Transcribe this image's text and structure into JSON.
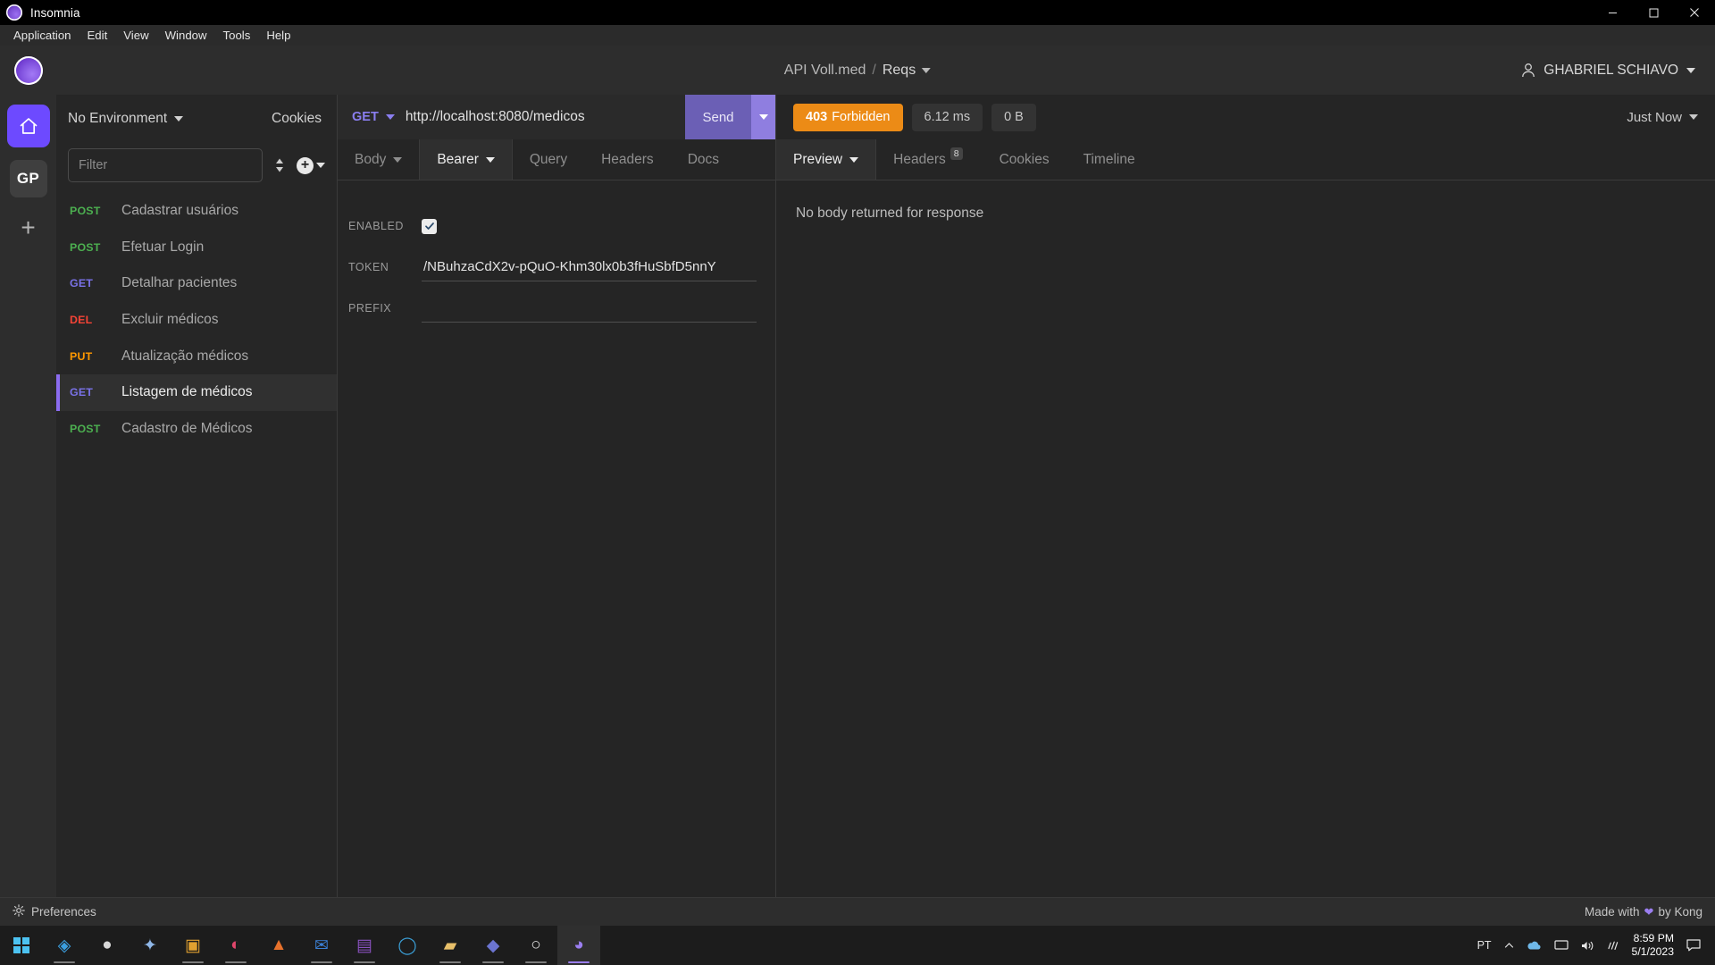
{
  "window": {
    "app_title": "Insomnia",
    "controls": {
      "minimize": "minimize-button",
      "maximize": "maximize-button",
      "close": "close-button"
    }
  },
  "menubar": {
    "items": [
      {
        "label": "Application"
      },
      {
        "label": "Edit"
      },
      {
        "label": "View"
      },
      {
        "label": "Window"
      },
      {
        "label": "Tools"
      },
      {
        "label": "Help"
      }
    ]
  },
  "header": {
    "workspace": "API Voll.med",
    "separator": "/",
    "collection": "Reqs",
    "user": "GHABRIEL SCHIAVO"
  },
  "rail": {
    "home_icon": "home-icon",
    "avatar_initials": "GP",
    "add_label": "+"
  },
  "sidebar": {
    "environment": "No Environment",
    "cookies": "Cookies",
    "filter_placeholder": "Filter",
    "filter_value": "",
    "requests": [
      {
        "method": "POST",
        "name": "Cadastrar usuários",
        "active": false
      },
      {
        "method": "POST",
        "name": "Efetuar Login",
        "active": false
      },
      {
        "method": "GET",
        "name": "Detalhar pacientes",
        "active": false
      },
      {
        "method": "DEL",
        "name": "Excluir médicos",
        "active": false
      },
      {
        "method": "PUT",
        "name": "Atualização médicos",
        "active": false
      },
      {
        "method": "GET",
        "name": "Listagem de médicos",
        "active": true
      },
      {
        "method": "POST",
        "name": "Cadastro de Médicos",
        "active": false
      }
    ]
  },
  "request": {
    "method": "GET",
    "url": "http://localhost:8080/medicos",
    "send_label": "Send",
    "tabs": [
      {
        "label": "Body",
        "has_caret": true,
        "active": false
      },
      {
        "label": "Bearer",
        "has_caret": true,
        "active": true
      },
      {
        "label": "Query",
        "has_caret": false,
        "active": false
      },
      {
        "label": "Headers",
        "has_caret": false,
        "active": false
      },
      {
        "label": "Docs",
        "has_caret": false,
        "active": false
      }
    ],
    "auth": {
      "enabled_label": "ENABLED",
      "enabled_checked": true,
      "token_label": "TOKEN",
      "token_value": "/NBuhzaCdX2v-pQuO-Khm30lx0b3fHuSbfD5nnY",
      "prefix_label": "PREFIX",
      "prefix_value": ""
    }
  },
  "response": {
    "status_code": "403",
    "status_text": "Forbidden",
    "time": "6.12 ms",
    "size": "0 B",
    "timestamp": "Just Now",
    "tabs": [
      {
        "label": "Preview",
        "has_caret": true,
        "badge": "",
        "active": true
      },
      {
        "label": "Headers",
        "has_caret": false,
        "badge": "8",
        "active": false
      },
      {
        "label": "Cookies",
        "has_caret": false,
        "badge": "",
        "active": false
      },
      {
        "label": "Timeline",
        "has_caret": false,
        "badge": "",
        "active": false
      }
    ],
    "body_message": "No body returned for response"
  },
  "footer": {
    "preferences": "Preferences",
    "made_with_pre": "Made with",
    "made_with_post": "by Kong"
  },
  "taskbar": {
    "language": "PT",
    "time": "8:59 PM",
    "date": "5/1/2023",
    "apps": [
      {
        "name": "vscode",
        "glyph": "◈",
        "color": "#3b9fe0",
        "running": true,
        "active": false
      },
      {
        "name": "github-desktop",
        "glyph": "●",
        "color": "#d8d8d8",
        "running": false,
        "active": false
      },
      {
        "name": "insomnia-designer",
        "glyph": "✦",
        "color": "#8fb7e8",
        "running": false,
        "active": false
      },
      {
        "name": "mysql-workbench",
        "glyph": "▣",
        "color": "#e0a030",
        "running": true,
        "active": false
      },
      {
        "name": "intellij-idea",
        "glyph": "◐",
        "color": "#e0466b",
        "running": true,
        "active": false
      },
      {
        "name": "postman",
        "glyph": "▲",
        "color": "#e8722c",
        "running": false,
        "active": false
      },
      {
        "name": "outlook",
        "glyph": "✉",
        "color": "#3b7fd4",
        "running": true,
        "active": false
      },
      {
        "name": "onenote",
        "glyph": "▤",
        "color": "#8a52c0",
        "running": true,
        "active": false
      },
      {
        "name": "edge",
        "glyph": "◯",
        "color": "#3ba0d8",
        "running": false,
        "active": false
      },
      {
        "name": "file-explorer",
        "glyph": "▰",
        "color": "#e8c06a",
        "running": true,
        "active": false
      },
      {
        "name": "teams",
        "glyph": "◆",
        "color": "#6b74d0",
        "running": true,
        "active": false
      },
      {
        "name": "chrome",
        "glyph": "○",
        "color": "#e0e0e0",
        "running": true,
        "active": false
      },
      {
        "name": "insomnia",
        "glyph": "◕",
        "color": "#9b7ef0",
        "running": true,
        "active": true
      }
    ]
  }
}
